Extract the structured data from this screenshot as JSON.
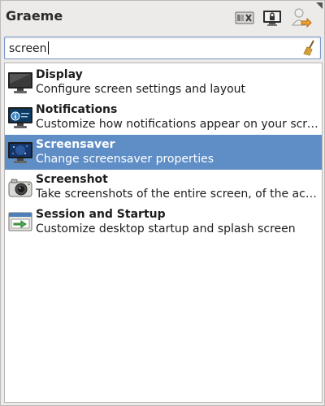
{
  "header": {
    "username": "Graeme"
  },
  "search": {
    "value": "screen"
  },
  "results": [
    {
      "title": "Display",
      "description": "Configure screen settings and layout",
      "icon": "display-icon",
      "selected": false
    },
    {
      "title": "Notifications",
      "description": "Customize how notifications appear on your screen",
      "icon": "notifications-icon",
      "selected": false
    },
    {
      "title": "Screensaver",
      "description": "Change screensaver properties",
      "icon": "screensaver-icon",
      "selected": true
    },
    {
      "title": "Screenshot",
      "description": "Take screenshots of the entire screen, of the active...",
      "icon": "camera-icon",
      "selected": false
    },
    {
      "title": "Session and Startup",
      "description": "Customize desktop startup and splash screen",
      "icon": "session-startup-icon",
      "selected": false
    }
  ],
  "colors": {
    "selection": "#5f8ec6",
    "window_bg": "#ecebe9"
  }
}
